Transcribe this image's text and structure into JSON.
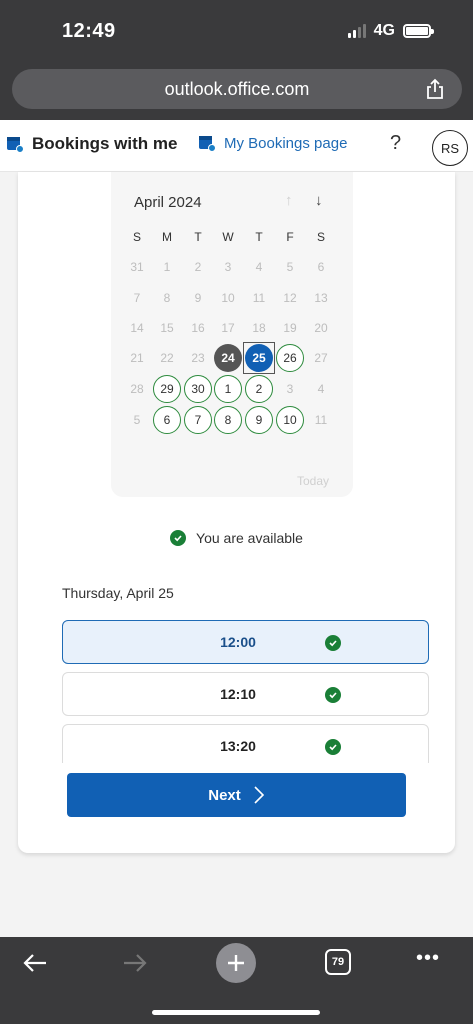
{
  "status": {
    "time": "12:49",
    "network": "4G"
  },
  "browser": {
    "url": "outlook.office.com",
    "tab_count": "79"
  },
  "header": {
    "title": "Bookings with me",
    "link": "My Bookings page",
    "help": "?",
    "avatar": "RS"
  },
  "calendar": {
    "month": "April 2024",
    "weekdays": [
      "S",
      "M",
      "T",
      "W",
      "T",
      "F",
      "S"
    ],
    "rows": [
      [
        "31",
        "1",
        "2",
        "3",
        "4",
        "5",
        "6"
      ],
      [
        "7",
        "8",
        "9",
        "10",
        "11",
        "12",
        "13"
      ],
      [
        "14",
        "15",
        "16",
        "17",
        "18",
        "19",
        "20"
      ],
      [
        "21",
        "22",
        "23",
        "24",
        "25",
        "26",
        "27"
      ],
      [
        "28",
        "29",
        "30",
        "1",
        "2",
        "3",
        "4"
      ],
      [
        "5",
        "6",
        "7",
        "8",
        "9",
        "10",
        "11"
      ]
    ],
    "today_label": "Today",
    "today_day": "24",
    "selected_day": "25",
    "available_days": [
      "26",
      "29",
      "30",
      "1",
      "2",
      "6",
      "7",
      "8",
      "9",
      "10"
    ]
  },
  "availability": "You are available",
  "selected_date": "Thursday, April 25",
  "slots": [
    {
      "time": "12:00",
      "active": true
    },
    {
      "time": "12:10",
      "active": false
    },
    {
      "time": "13:20",
      "active": false
    }
  ],
  "next_label": "Next",
  "colors": {
    "primary": "#1160b4",
    "available": "#2e8b3e",
    "check": "#1a7f37"
  }
}
